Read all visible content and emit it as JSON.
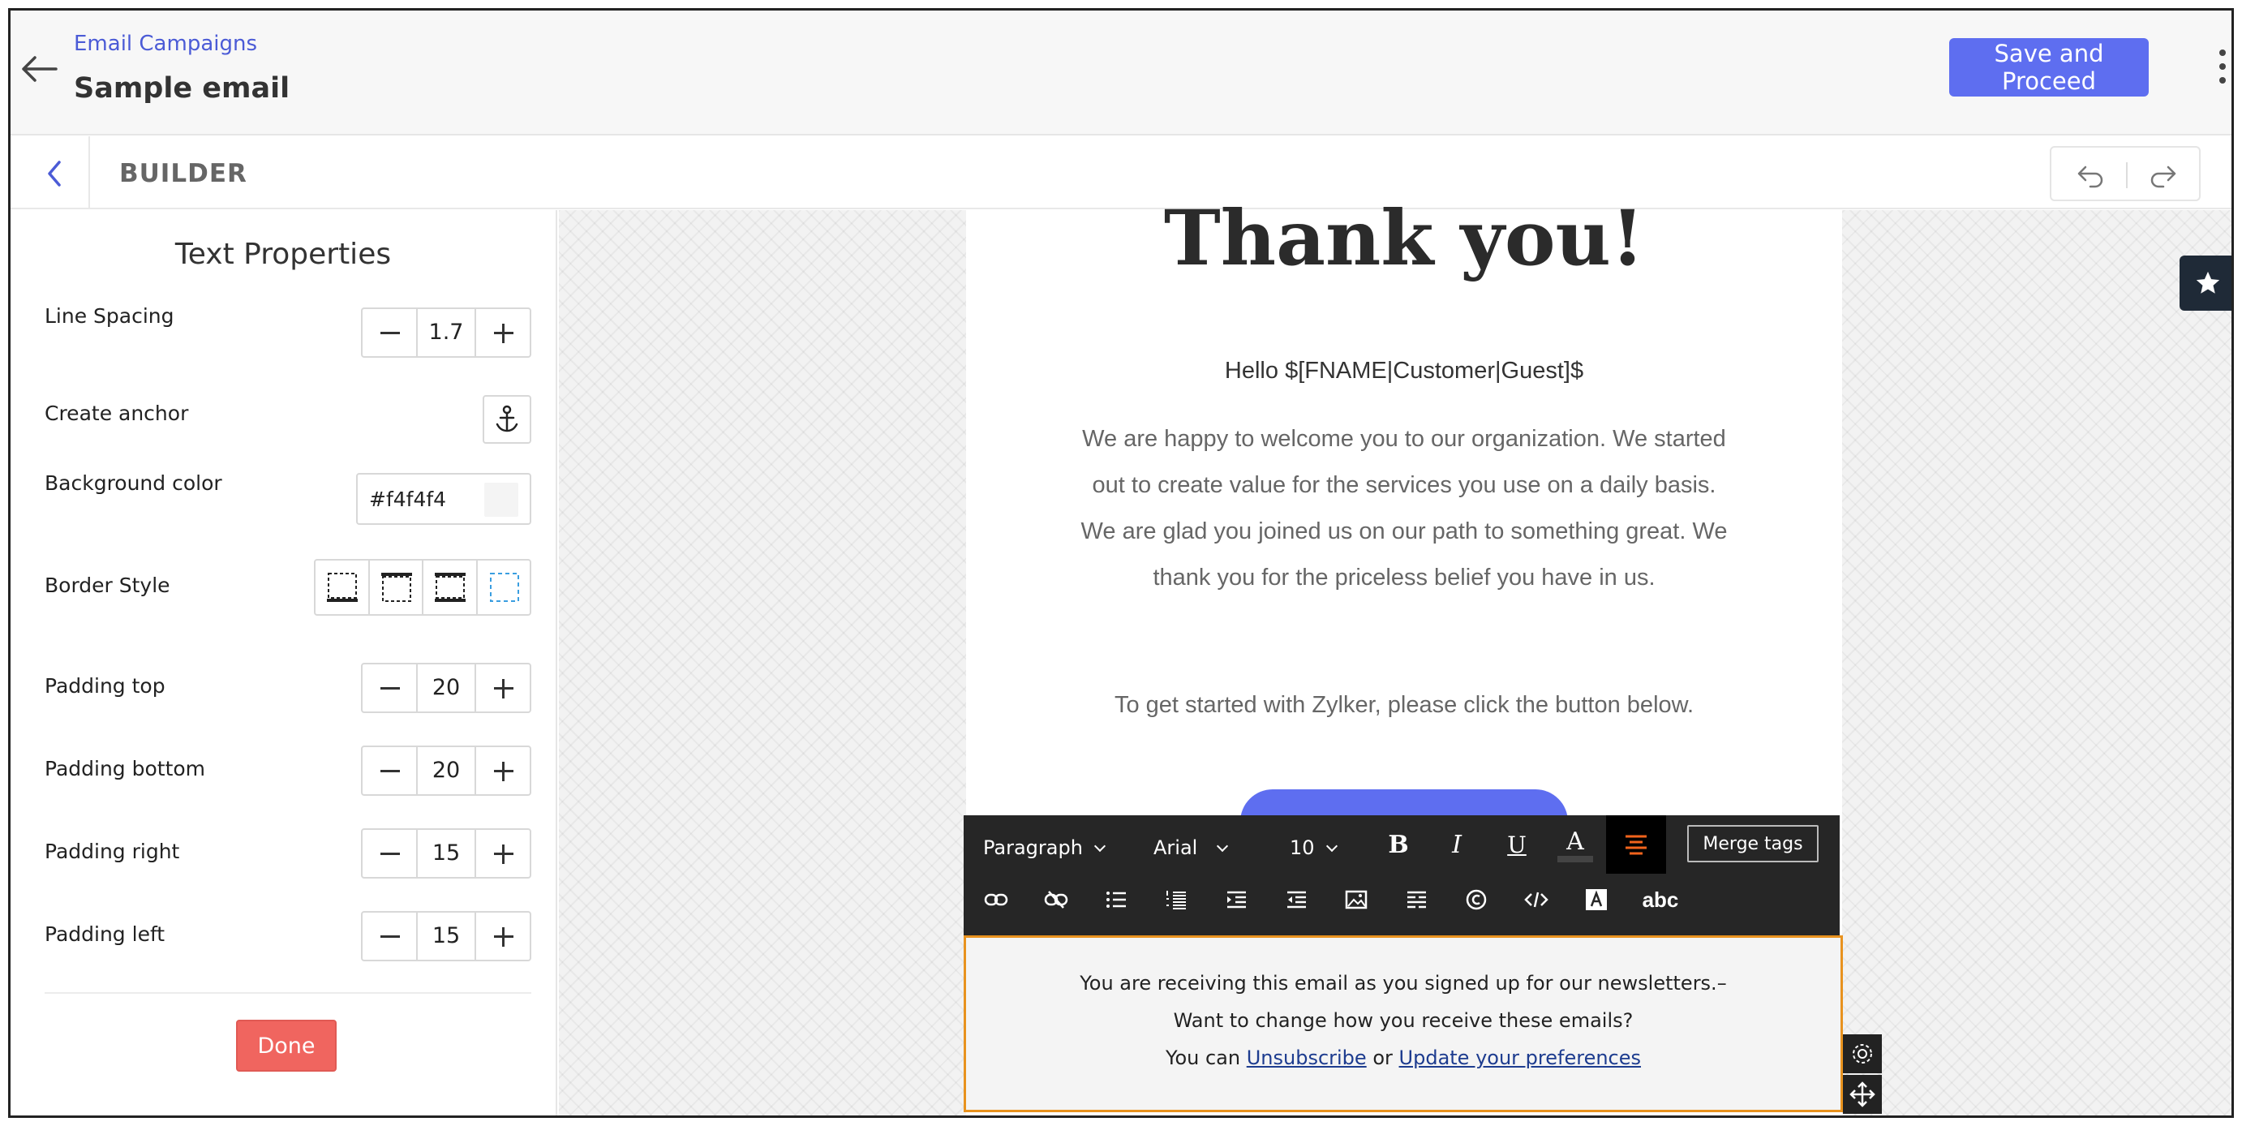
{
  "header": {
    "breadcrumb": "Email Campaigns",
    "title": "Sample email",
    "save_label": "Save and Proceed"
  },
  "builder": {
    "label": "BUILDER"
  },
  "panel": {
    "title": "Text Properties",
    "line_spacing": {
      "label": "Line Spacing",
      "value": "1.7"
    },
    "create_anchor": {
      "label": "Create anchor"
    },
    "background_color": {
      "label": "Background color",
      "value": "#f4f4f4"
    },
    "border_style": {
      "label": "Border Style"
    },
    "padding_top": {
      "label": "Padding top",
      "value": "20"
    },
    "padding_bottom": {
      "label": "Padding bottom",
      "value": "20"
    },
    "padding_right": {
      "label": "Padding right",
      "value": "15"
    },
    "padding_left": {
      "label": "Padding left",
      "value": "15"
    },
    "done_label": "Done"
  },
  "email": {
    "heading": "Thank you!",
    "greeting": "Hello $[FNAME|Customer|Guest]$",
    "body": "We are happy to welcome you to our organization. We started out to create value for the services you use on a daily basis. We are glad you joined us on our path to something great. We thank you for the priceless belief you have in us.",
    "started": "To get started with Zylker, please click the button below."
  },
  "toolbar": {
    "block_format": "Paragraph",
    "font": "Arial",
    "size": "10",
    "bold": "B",
    "italic": "I",
    "underline": "U",
    "font_color": "A",
    "merge_tags": "Merge tags",
    "spellcheck": "abc"
  },
  "footer": {
    "line1": "You are receiving this email as you signed up for our newsletters.–",
    "line2": "Want to change how you receive these emails?",
    "line3_prefix": "You can",
    "unsubscribe": "Unsubscribe",
    "or": "or",
    "update_prefs": "Update your preferences"
  },
  "colors": {
    "accent": "#5e6ef0",
    "done": "#f0655f",
    "selection": "#e8921e"
  }
}
